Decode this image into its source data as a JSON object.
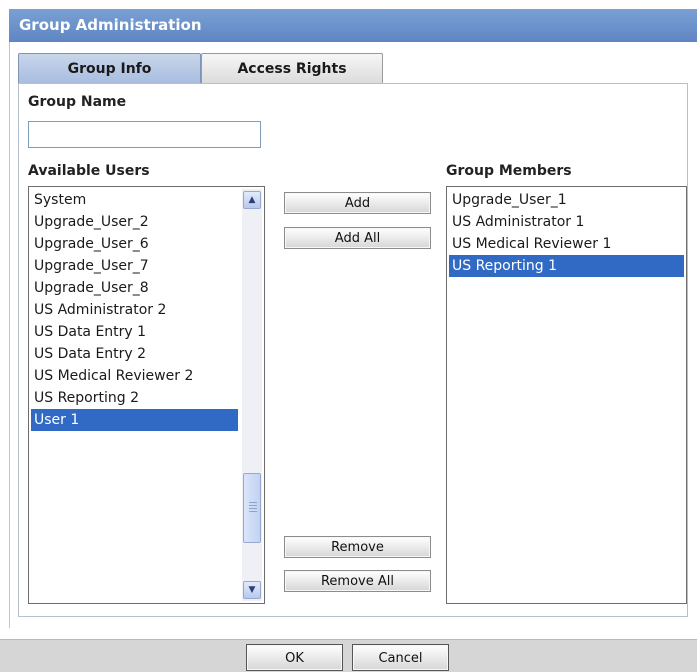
{
  "window": {
    "title": "Group Administration"
  },
  "tabs": [
    {
      "label": "Group Info",
      "active": true
    },
    {
      "label": "Access Rights",
      "active": false
    }
  ],
  "group_name": {
    "label": "Group Name",
    "value": ""
  },
  "available_users": {
    "label": "Available Users",
    "items": [
      "System",
      "Upgrade_User_2",
      "Upgrade_User_6",
      "Upgrade_User_7",
      "Upgrade_User_8",
      "US Administrator 2",
      "US Data Entry 1",
      "US Data Entry 2",
      "US Medical Reviewer 2",
      "US Reporting 2",
      "User 1"
    ],
    "selected": "User 1"
  },
  "buttons": {
    "add": "Add",
    "add_all": "Add All",
    "remove": "Remove",
    "remove_all": "Remove All",
    "ok": "OK",
    "cancel": "Cancel"
  },
  "group_members": {
    "label": "Group Members",
    "items": [
      "Upgrade_User_1",
      "US Administrator 1",
      "US Medical Reviewer 1",
      "US Reporting 1"
    ],
    "selected": "US Reporting 1"
  },
  "icons": {
    "scroll_up": "chevron-up-icon",
    "scroll_down": "chevron-down-icon",
    "scroll_grip": "grip-icon"
  },
  "colors": {
    "title_bar": "#6a90c9",
    "selection": "#316ac5",
    "active_tab": "#b7c9e6"
  }
}
